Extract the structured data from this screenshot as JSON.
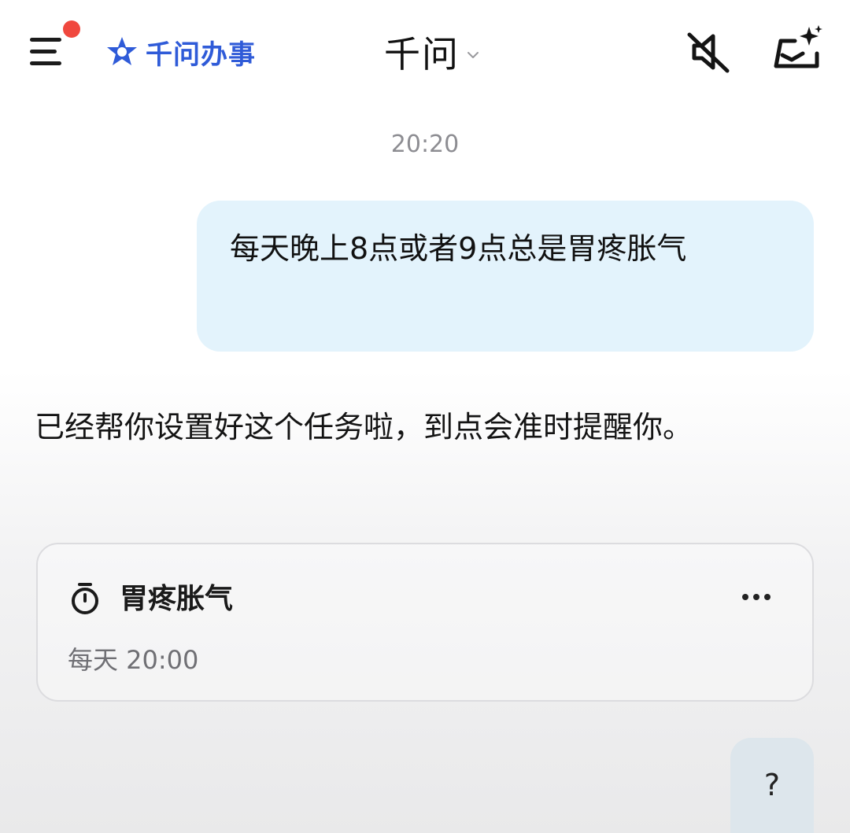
{
  "header": {
    "brand_label": "千问办事",
    "title": "千问"
  },
  "chat": {
    "timestamp": "20:20",
    "user_message": "每天晚上8点或者9点总是胃疼胀气",
    "assistant_reply": "已经帮你设置好这个任务啦，到点会准时提醒你。",
    "reminder_card": {
      "title": "胃疼胀气",
      "schedule": "每天 20:00"
    },
    "next_user_message": "?"
  },
  "icons": {
    "menu": "menu-icon",
    "notification_dot": "notification-dot",
    "brand_logo": "star-logo-icon",
    "title_dropdown": "chevron-down-icon",
    "mute": "speaker-muted-icon",
    "new_chat": "new-chat-sparkle-icon",
    "timer": "timer-icon",
    "more": "more-dots-icon"
  },
  "colors": {
    "brand": "#2f5bd8",
    "user_bubble": "#e3f3fc",
    "notification_dot": "#f0483e",
    "muted_text": "#8d8d92"
  }
}
